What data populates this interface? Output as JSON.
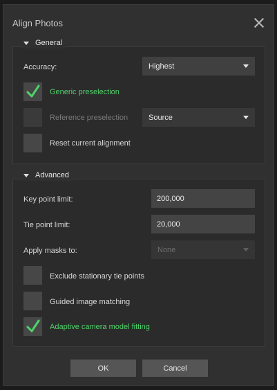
{
  "dialog": {
    "title": "Align Photos",
    "close_icon": "close-icon"
  },
  "general": {
    "header": "General",
    "accuracy_label": "Accuracy:",
    "accuracy_value": "Highest",
    "generic_preselection": {
      "label": "Generic preselection",
      "checked": true
    },
    "reference_preselection": {
      "label": "Reference preselection",
      "checked": false,
      "enabled": false
    },
    "reference_source_value": "Source",
    "reset_alignment": {
      "label": "Reset current alignment",
      "checked": false
    }
  },
  "advanced": {
    "header": "Advanced",
    "key_point_limit_label": "Key point limit:",
    "key_point_limit_value": "200,000",
    "tie_point_limit_label": "Tie point limit:",
    "tie_point_limit_value": "20,000",
    "apply_masks_label": "Apply masks to:",
    "apply_masks_value": "None",
    "exclude_stationary": {
      "label": "Exclude stationary tie points",
      "checked": false
    },
    "guided_matching": {
      "label": "Guided image matching",
      "checked": false
    },
    "adaptive_fitting": {
      "label": "Adaptive camera model fitting",
      "checked": true
    }
  },
  "buttons": {
    "ok": "OK",
    "cancel": "Cancel"
  },
  "colors": {
    "accent_green": "#4fd36a",
    "dialog_bg": "#303030"
  }
}
